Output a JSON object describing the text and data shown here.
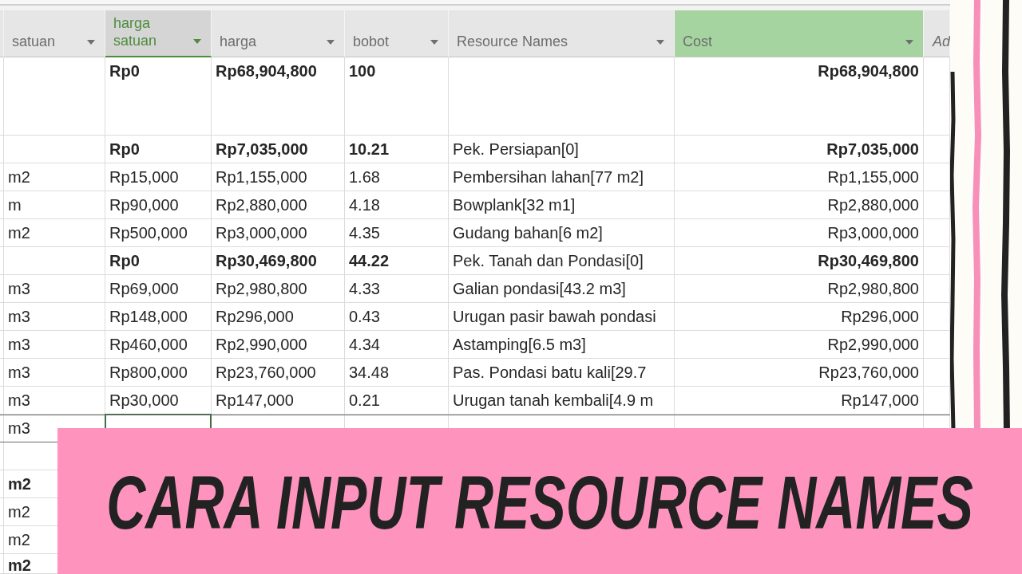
{
  "table": {
    "columns": [
      {
        "label": "satuan",
        "kind": "field",
        "selected": false,
        "highlighted": false
      },
      {
        "label": "harga satuan",
        "kind": "field",
        "selected": true,
        "highlighted": false
      },
      {
        "label": "harga",
        "kind": "field",
        "selected": false,
        "highlighted": false
      },
      {
        "label": "bobot",
        "kind": "field",
        "selected": false,
        "highlighted": false
      },
      {
        "label": "Resource Names",
        "kind": "field",
        "selected": false,
        "highlighted": false
      },
      {
        "label": "Cost",
        "kind": "field",
        "selected": false,
        "highlighted": true
      },
      {
        "label": "Ad",
        "kind": "add",
        "selected": false,
        "highlighted": false
      }
    ],
    "rows": [
      {
        "kind": "project",
        "selected": false,
        "harga_satuan": "Rp0",
        "harga": "Rp68,904,800",
        "bobot": "100",
        "cost": "Rp68,904,800"
      },
      {
        "kind": "summary",
        "selected": false,
        "harga_satuan": "Rp0",
        "harga": "Rp7,035,000",
        "bobot": "10.21",
        "resource_names": "Pek. Persiapan[0]",
        "cost": "Rp7,035,000"
      },
      {
        "kind": "task",
        "selected": false,
        "satuan": "m2",
        "harga_satuan": "Rp15,000",
        "harga": "Rp1,155,000",
        "bobot": "1.68",
        "resource_names": "Pembersihan lahan[77 m2]",
        "cost": "Rp1,155,000"
      },
      {
        "kind": "task",
        "selected": false,
        "satuan": "m",
        "harga_satuan": "Rp90,000",
        "harga": "Rp2,880,000",
        "bobot": "4.18",
        "resource_names": "Bowplank[32 m1]",
        "cost": "Rp2,880,000"
      },
      {
        "kind": "task",
        "selected": false,
        "satuan": "m2",
        "harga_satuan": "Rp500,000",
        "harga": "Rp3,000,000",
        "bobot": "4.35",
        "resource_names": "Gudang bahan[6 m2]",
        "cost": "Rp3,000,000"
      },
      {
        "kind": "summary",
        "selected": false,
        "harga_satuan": "Rp0",
        "harga": "Rp30,469,800",
        "bobot": "44.22",
        "resource_names": "Pek. Tanah dan Pondasi[0]",
        "cost": "Rp30,469,800"
      },
      {
        "kind": "task",
        "selected": false,
        "satuan": "m3",
        "harga_satuan": "Rp69,000",
        "harga": "Rp2,980,800",
        "bobot": "4.33",
        "resource_names": "Galian pondasi[43.2 m3]",
        "cost": "Rp2,980,800"
      },
      {
        "kind": "task",
        "selected": false,
        "satuan": "m3",
        "harga_satuan": "Rp148,000",
        "harga": "Rp296,000",
        "bobot": "0.43",
        "resource_names": "Urugan pasir bawah pondasi",
        "cost": "Rp296,000"
      },
      {
        "kind": "task",
        "selected": false,
        "satuan": "m3",
        "harga_satuan": "Rp460,000",
        "harga": "Rp2,990,000",
        "bobot": "4.34",
        "resource_names": "Astamping[6.5 m3]",
        "cost": "Rp2,990,000"
      },
      {
        "kind": "task",
        "selected": false,
        "satuan": "m3",
        "harga_satuan": "Rp800,000",
        "harga": "Rp23,760,000",
        "bobot": "34.48",
        "resource_names": "Pas. Pondasi batu kali[29.7",
        "cost": "Rp23,760,000"
      },
      {
        "kind": "task",
        "selected": false,
        "satuan": "m3",
        "harga_satuan": "Rp30,000",
        "harga": "Rp147,000",
        "bobot": "0.21",
        "resource_names": "Urugan tanah kembali[4.9 m",
        "cost": "Rp147,000"
      },
      {
        "kind": "task",
        "selected": true,
        "satuan": "m3"
      },
      {
        "kind": "task",
        "selected": false
      },
      {
        "kind": "summary",
        "selected": false,
        "satuan": "m2"
      },
      {
        "kind": "task",
        "selected": false,
        "satuan": "m2"
      },
      {
        "kind": "task",
        "selected": false,
        "satuan": "m2"
      },
      {
        "kind": "summary",
        "selected": false,
        "satuan": "m2"
      }
    ]
  },
  "banner": {
    "title": "CARA INPUT RESOURCE NAMES"
  }
}
